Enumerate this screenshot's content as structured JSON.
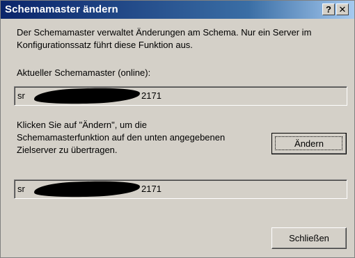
{
  "window": {
    "title": "Schemamaster ändern",
    "help_label": "?",
    "close_label": "✕"
  },
  "description": "Der Schemamaster verwaltet Änderungen am Schema. Nur ein Server im Konfigurationssatz führt diese Funktion aus.",
  "current": {
    "label": "Aktueller Schemamaster (online):",
    "value_prefix": "sr",
    "value_suffix": "2171"
  },
  "instructions": "Klicken Sie auf \"Ändern\", um die Schemamasterfunktion auf den unten angegebenen Zielserver zu übertragen.",
  "target": {
    "value_prefix": "sr",
    "value_suffix": "2171"
  },
  "buttons": {
    "change": "Ändern",
    "close": "Schließen"
  }
}
